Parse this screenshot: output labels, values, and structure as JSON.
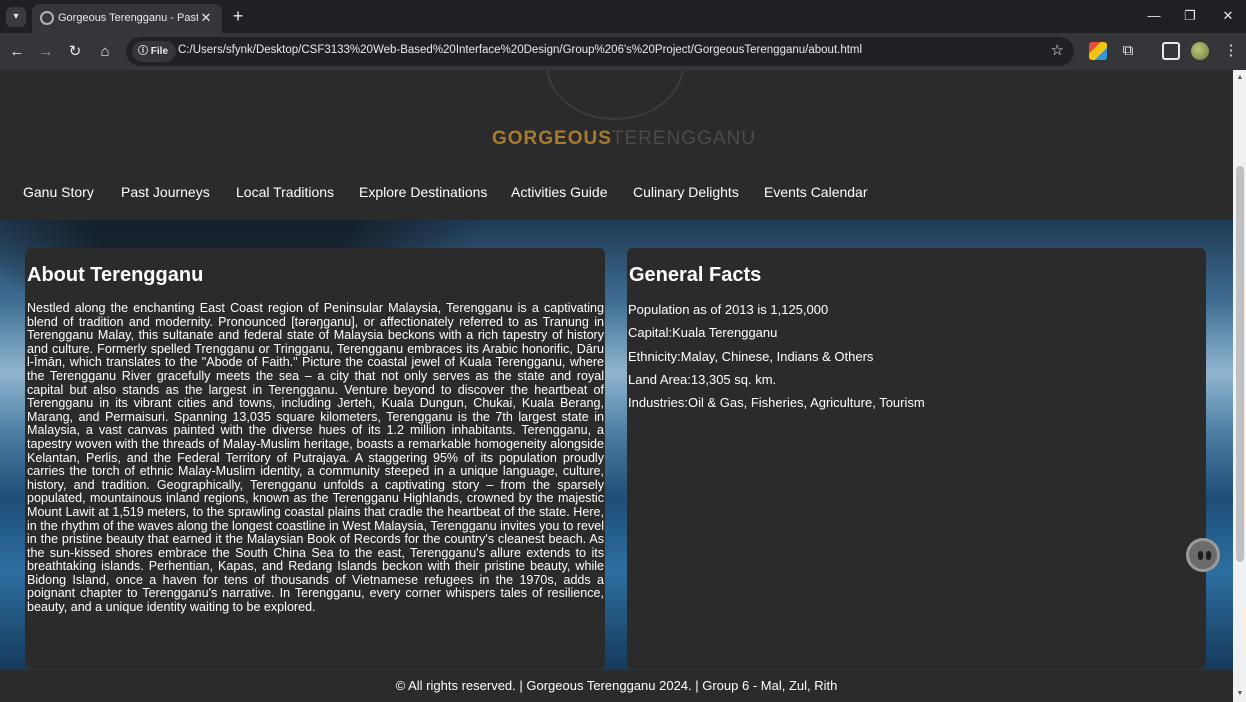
{
  "browser": {
    "tab_title": "Gorgeous Terengganu - Past Jo",
    "tab_close": "✕",
    "new_tab": "+",
    "url_chip": "File",
    "url": "C:/Users/sfynk/Desktop/CSF3133%20Web-Based%20Interface%20Design/Group%206's%20Project/GorgeousTerengganu/about.html"
  },
  "logo": {
    "part1": "GORGEOUS",
    "part2": "TERENGGANU"
  },
  "nav": {
    "items": [
      {
        "label": "Ganu Story"
      },
      {
        "label": "Past Journeys"
      },
      {
        "label": "Local Traditions"
      },
      {
        "label": "Explore Destinations"
      },
      {
        "label": "Activities Guide"
      },
      {
        "label": "Culinary Delights"
      },
      {
        "label": "Events Calendar"
      }
    ]
  },
  "about": {
    "title": "About Terengganu",
    "body": "Nestled along the enchanting East Coast region of Peninsular Malaysia, Terengganu is a captivating blend of tradition and modernity. Pronounced [tərəŋganu], or affectionately referred to as Tranung in Terengganu Malay, this sultanate and federal state of Malaysia beckons with a rich tapestry of history and culture. Formerly spelled Trengganu or Tringganu, Terengganu embraces its Arabic honorific, Dāru l-Īmān, which translates to the \"Abode of Faith.\" Picture the coastal jewel of Kuala Terengganu, where the Terengganu River gracefully meets the sea – a city that not only serves as the state and royal capital but also stands as the largest in Terengganu. Venture beyond to discover the heartbeat of Terengganu in its vibrant cities and towns, including Jerteh, Kuala Dungun, Chukai, Kuala Berang, Marang, and Permaisuri. Spanning 13,035 square kilometers, Terengganu is the 7th largest state in Malaysia, a vast canvas painted with the diverse hues of its 1.2 million inhabitants. Terengganu, a tapestry woven with the threads of Malay-Muslim heritage, boasts a remarkable homogeneity alongside Kelantan, Perlis, and the Federal Territory of Putrajaya. A staggering 95% of its population proudly carries the torch of ethnic Malay-Muslim identity, a community steeped in a unique language, culture, history, and tradition. Geographically, Terengganu unfolds a captivating story – from the sparsely populated, mountainous inland regions, known as the Terengganu Highlands, crowned by the majestic Mount Lawit at 1,519 meters, to the sprawling coastal plains that cradle the heartbeat of the state. Here, in the rhythm of the waves along the longest coastline in West Malaysia, Terengganu invites you to revel in the pristine beauty that earned it the Malaysian Book of Records for the country's cleanest beach. As the sun-kissed shores embrace the South China Sea to the east, Terengganu's allure extends to its breathtaking islands. Perhentian, Kapas, and Redang Islands beckon with their pristine beauty, while Bidong Island, once a haven for tens of thousands of Vietnamese refugees in the 1970s, adds a poignant chapter to Terengganu's narrative. In Terengganu, every corner whispers tales of resilience, beauty, and a unique identity waiting to be explored."
  },
  "facts": {
    "title": "General Facts",
    "items": [
      {
        "text": "Population as of 2013 is 1,125,000"
      },
      {
        "text": "Capital:Kuala Terengganu"
      },
      {
        "text": "Ethnicity:Malay, Chinese, Indians & Others"
      },
      {
        "text": "Land Area:13,305 sq. km."
      },
      {
        "text": "Industries:Oil & Gas, Fisheries, Agriculture, Tourism"
      }
    ]
  },
  "footer": {
    "text": "© All rights reserved. | Gorgeous Terengganu 2024. | Group 6 - Mal, Zul, Rith"
  }
}
